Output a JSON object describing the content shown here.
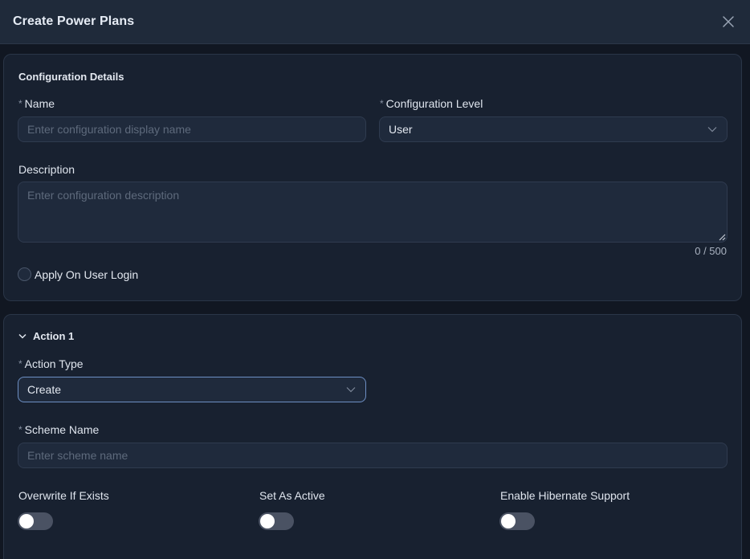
{
  "dialog": {
    "title": "Create Power Plans"
  },
  "config_details": {
    "section_title": "Configuration Details",
    "name": {
      "required": "*",
      "label": "Name",
      "placeholder": "Enter configuration display name",
      "value": ""
    },
    "config_level": {
      "required": "*",
      "label": "Configuration Level",
      "value": "User"
    },
    "description": {
      "label": "Description",
      "placeholder": "Enter configuration description",
      "value": "",
      "counter": "0 / 500"
    },
    "apply_on_login": {
      "label": "Apply On User Login",
      "checked": false
    }
  },
  "action": {
    "title": "Action 1",
    "action_type": {
      "required": "*",
      "label": "Action Type",
      "value": "Create"
    },
    "scheme_name": {
      "required": "*",
      "label": "Scheme Name",
      "placeholder": "Enter scheme name",
      "value": ""
    },
    "toggles": [
      {
        "label": "Overwrite If Exists",
        "on": false
      },
      {
        "label": "Set As Active",
        "on": false
      },
      {
        "label": "Enable Hibernate Support",
        "on": false
      }
    ]
  }
}
